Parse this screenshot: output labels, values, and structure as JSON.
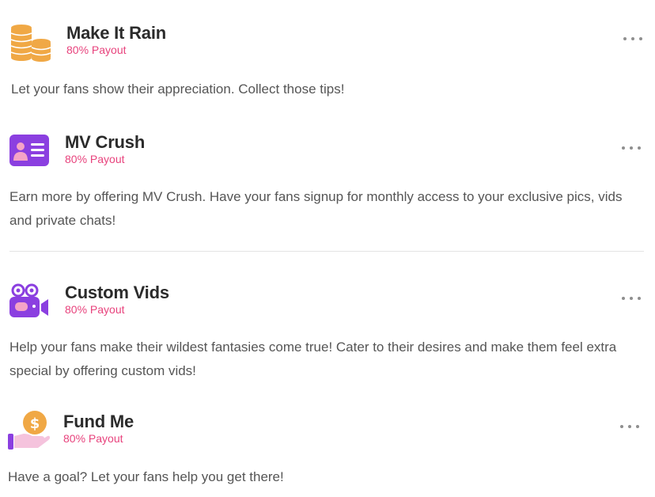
{
  "services": [
    {
      "icon": "coins-stack-icon",
      "title": "Make It Rain",
      "payout": "80% Payout",
      "description": "Let your fans show their appreciation. Collect those tips!"
    },
    {
      "icon": "id-card-icon",
      "title": "MV Crush",
      "payout": "80% Payout",
      "description": "Earn more by offering MV Crush. Have your fans signup for monthly access to your exclusive pics, vids and private chats!"
    },
    {
      "icon": "video-camera-icon",
      "title": "Custom Vids",
      "payout": "80% Payout",
      "description": "Help your fans make their wildest fantasies come true! Cater to their desires and make them feel extra special by offering custom vids!"
    },
    {
      "icon": "hand-coin-icon",
      "title": "Fund Me",
      "payout": "80% Payout",
      "description": "Have a goal? Let your fans help you get there!"
    }
  ],
  "colors": {
    "payout": "#e8437d",
    "purple": "#8b3fe0",
    "coin": "#f0a845"
  }
}
